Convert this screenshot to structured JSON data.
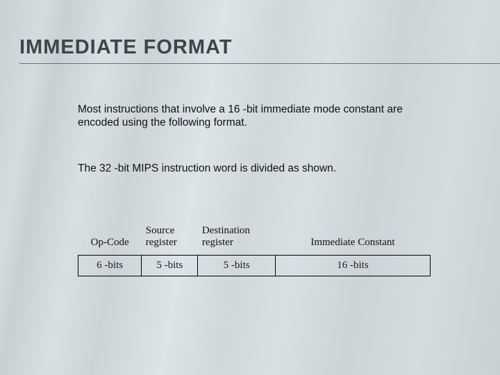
{
  "title": "IMMEDIATE FORMAT",
  "para1": "Most instructions that involve a 16 -bit immediate mode constant are encoded using the following format.",
  "para2": "The 32 -bit MIPS instruction word is divided as shown.",
  "table": {
    "headers": {
      "opcode": "Op-Code",
      "source": "Source register",
      "dest": "Destination register",
      "imm": "Immediate Constant"
    },
    "bits": {
      "opcode": "6 -bits",
      "source": "5 -bits",
      "dest": "5 -bits",
      "imm": "16 -bits"
    }
  }
}
